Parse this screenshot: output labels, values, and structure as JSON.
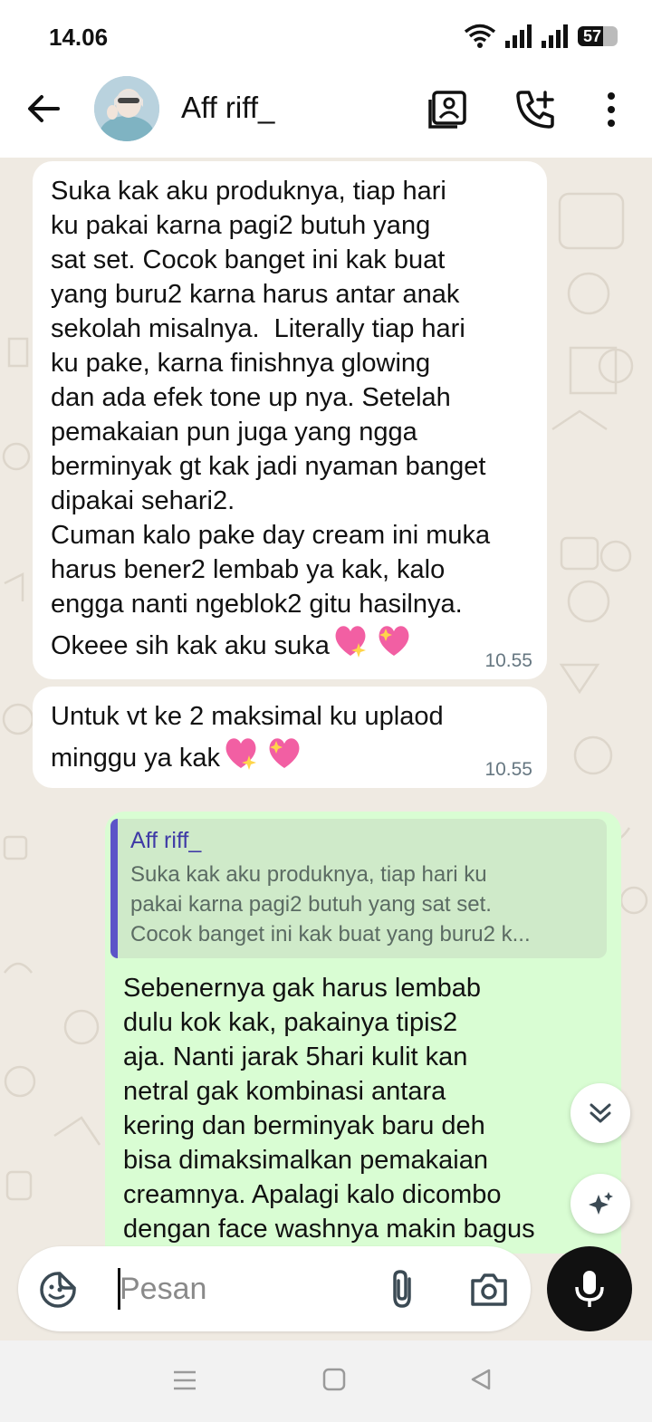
{
  "status_bar": {
    "time": "14.06",
    "battery": "57"
  },
  "header": {
    "contact_name": "Aff riff_",
    "icons": [
      "back-arrow-icon",
      "contact-card-icon",
      "add-call-icon",
      "more-vert-icon"
    ]
  },
  "messages": [
    {
      "direction": "incoming",
      "text": "Suka kak aku produknya, tiap hari\nku pakai karna pagi2 butuh yang\nsat set. Cocok banget ini kak buat\nyang buru2 karna harus antar anak\nsekolah misalnya.  Literally tiap hari\nku pake, karna finishnya glowing\ndan ada efek tone up nya. Setelah\npemakaian pun juga yang ngga\nberminyak gt kak jadi nyaman banget\ndipakai sehari2.\nCuman kalo pake day cream ini muka\nharus bener2 lembab ya kak, kalo\nengga nanti ngeblok2 gitu hasilnya.\nOkeee sih kak aku suka",
      "emoji": "sparkling-heart x2",
      "time": "10.55"
    },
    {
      "direction": "incoming",
      "text": "Untuk vt ke 2 maksimal ku uplaod\nminggu ya kak",
      "emoji": "sparkling-heart x2",
      "time": "10.55"
    },
    {
      "direction": "outgoing",
      "quote_name": "Aff riff_",
      "quote_text": "Suka kak aku produknya, tiap hari ku\npakai karna pagi2 butuh yang sat set.\nCocok banget ini kak buat yang buru2 k...",
      "text": "Sebenernya gak harus lembab\ndulu kok kak, pakainya tipis2\naja. Nanti jarak 5hari kulit kan\nnetral gak kombinasi antara\nkering dan berminyak baru deh\nbisa dimaksimalkan pemakaian\ncreamnya. Apalagi kalo dicombo\ndengan face washnya makin bagus"
    }
  ],
  "composer": {
    "placeholder": "Pesan"
  },
  "colors": {
    "incoming_bubble": "#ffffff",
    "outgoing_bubble": "#d9fdd3",
    "quote_accent": "#5c54c8",
    "wallpaper": "#efeae2",
    "mic_button": "#111111"
  }
}
